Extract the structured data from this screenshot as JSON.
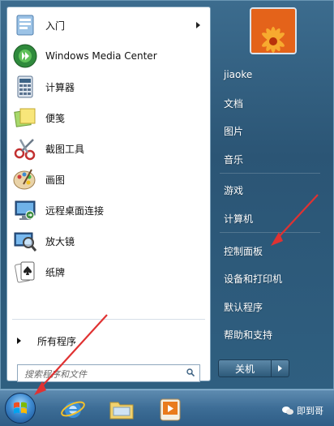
{
  "left_pane": {
    "apps": [
      {
        "label": "入门",
        "icon": "getting-started-icon",
        "has_submenu": true
      },
      {
        "label": "Windows Media Center",
        "icon": "windows-media-center-icon",
        "has_submenu": false
      },
      {
        "label": "计算器",
        "icon": "calculator-icon",
        "has_submenu": false
      },
      {
        "label": "便笺",
        "icon": "sticky-notes-icon",
        "has_submenu": false
      },
      {
        "label": "截图工具",
        "icon": "snipping-tool-icon",
        "has_submenu": false
      },
      {
        "label": "画图",
        "icon": "paint-icon",
        "has_submenu": false
      },
      {
        "label": "远程桌面连接",
        "icon": "remote-desktop-icon",
        "has_submenu": false
      },
      {
        "label": "放大镜",
        "icon": "magnifier-icon",
        "has_submenu": false
      },
      {
        "label": "纸牌",
        "icon": "solitaire-icon",
        "has_submenu": false
      }
    ],
    "all_programs_label": "所有程序",
    "search": {
      "placeholder": "搜索程序和文件",
      "value": ""
    }
  },
  "right_pane": {
    "user_name": "jiaoke",
    "items": [
      "文档",
      "图片",
      "音乐",
      "游戏",
      "计算机",
      "控制面板",
      "设备和打印机",
      "默认程序",
      "帮助和支持"
    ],
    "shutdown_label": "关机"
  },
  "taskbar": {
    "pinned": [
      "internet-explorer-icon",
      "file-explorer-icon",
      "media-player-icon"
    ],
    "watermark_text": "即到哥"
  },
  "colors": {
    "annotation_arrow": "#e03232",
    "menu_background": "#2f5f80"
  }
}
